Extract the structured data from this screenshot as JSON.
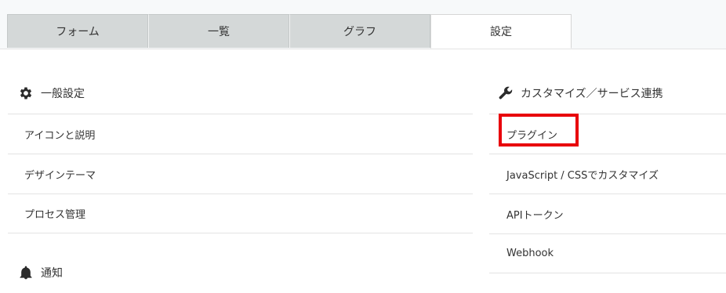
{
  "tabs": [
    {
      "label": "フォーム"
    },
    {
      "label": "一覧"
    },
    {
      "label": "グラフ"
    },
    {
      "label": "設定"
    }
  ],
  "general": {
    "title": "一般設定",
    "icon": "gear-icon",
    "items": [
      {
        "label": "アイコンと説明"
      },
      {
        "label": "デザインテーマ"
      },
      {
        "label": "プロセス管理"
      }
    ]
  },
  "notify": {
    "title": "通知",
    "icon": "bell-icon"
  },
  "customize": {
    "title": "カスタマイズ／サービス連携",
    "icon": "wrench-icon",
    "items": [
      {
        "label": "プラグイン"
      },
      {
        "label": "JavaScript / CSSでカスタマイズ"
      },
      {
        "label": "APIトークン"
      },
      {
        "label": "Webhook"
      }
    ]
  },
  "colors": {
    "highlight": "#e8000b",
    "tab_inactive": "#d4d8d8",
    "tab_active": "#ffffff"
  }
}
